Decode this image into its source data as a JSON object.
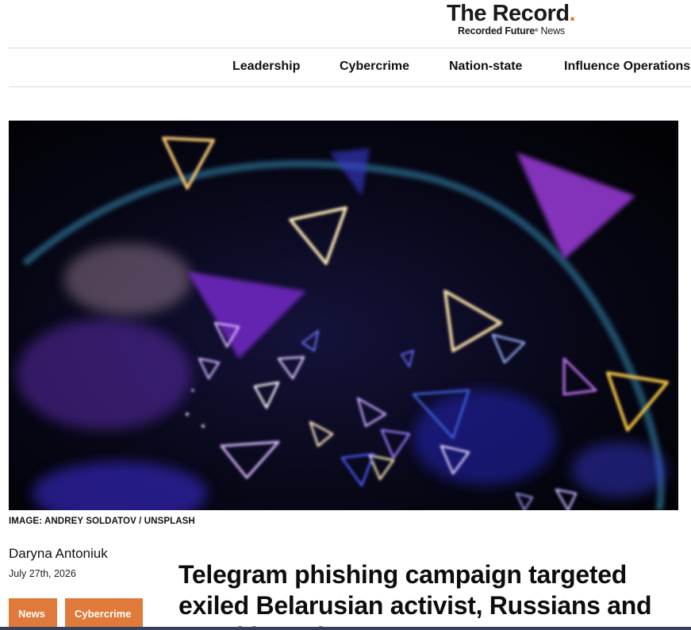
{
  "header": {
    "logo_title": "The Record",
    "logo_dot": ".",
    "logo_sub_brand": "Recorded Future",
    "logo_sub_mark": "®",
    "logo_sub_news": "News"
  },
  "nav": {
    "items": [
      {
        "label": "Leadership"
      },
      {
        "label": "Cybercrime"
      },
      {
        "label": "Nation-state"
      },
      {
        "label": "Influence Operations"
      }
    ]
  },
  "hero": {
    "caption": "IMAGE: ANDREY SOLDATOV / UNSPLASH"
  },
  "article": {
    "author": "Daryna Antoniuk",
    "date": "July 27th, 2026",
    "tags": [
      "News",
      "Cybercrime"
    ],
    "headline": "Telegram phishing campaign targeted exiled Belarusian activist, Russians and Kazakhstanis"
  },
  "colors": {
    "accent": "#e07a1f",
    "tag_bg": "#e07a3a"
  }
}
